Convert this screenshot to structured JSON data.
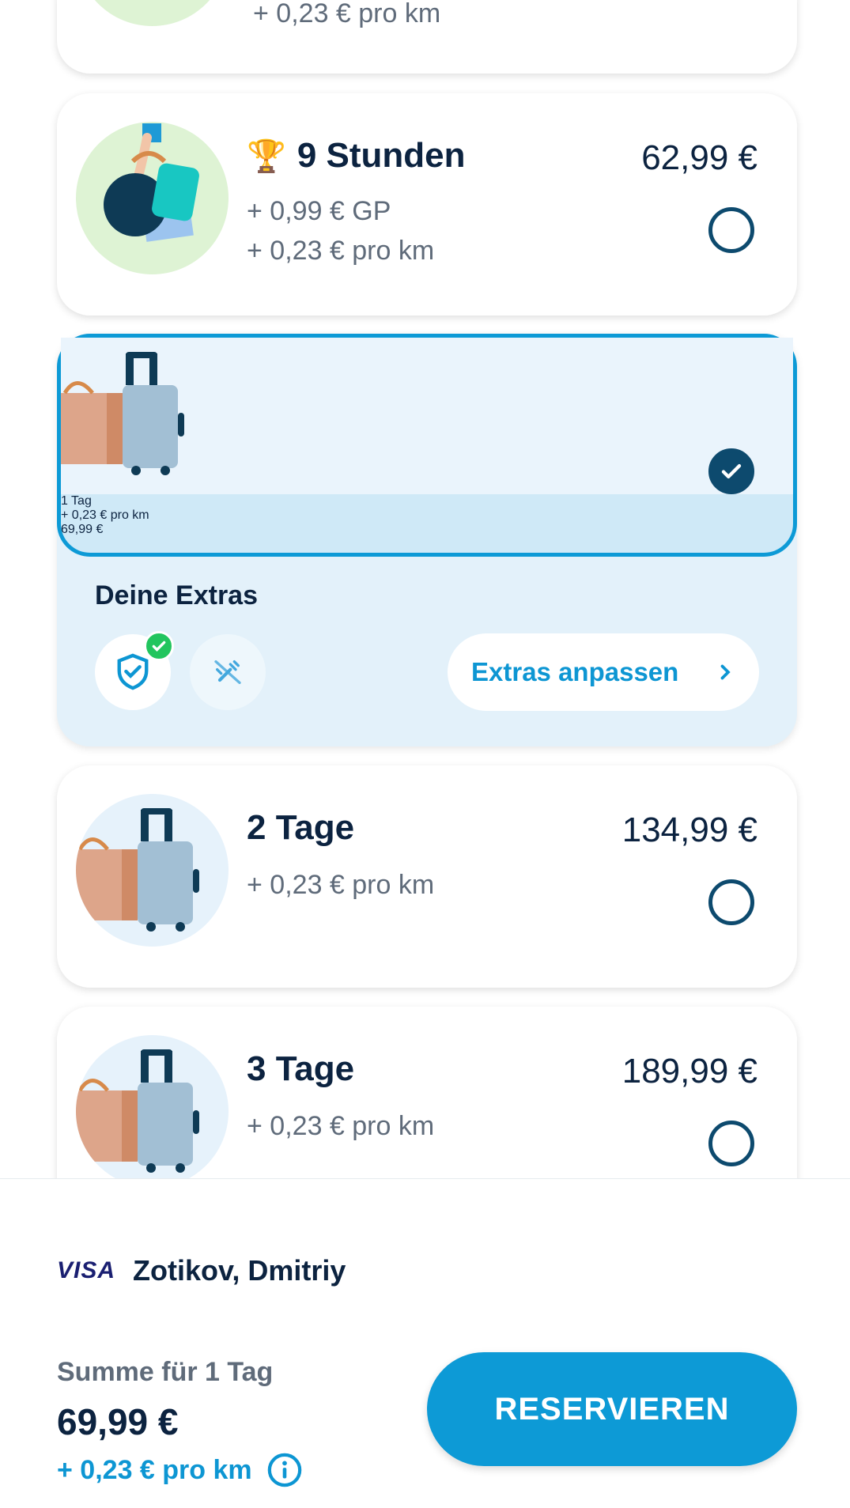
{
  "plans": [
    {
      "id": "prev",
      "sub": [
        "+ 0,23 € pro km"
      ],
      "selected": false
    },
    {
      "id": "9h",
      "trophy": "trophy-icon",
      "title": "9 Stunden",
      "price": "62,99 €",
      "sub": [
        "+ 0,99 € GP",
        "+ 0,23 € pro km"
      ],
      "selected": false
    },
    {
      "id": "1d",
      "title": "1 Tag",
      "price": "69,99 €",
      "sub": [
        "+ 0,23 € pro km"
      ],
      "selected": true
    },
    {
      "id": "2d",
      "title": "2 Tage",
      "price": "134,99 €",
      "sub": [
        "+ 0,23 € pro km"
      ],
      "selected": false
    },
    {
      "id": "3d",
      "title": "3 Tage",
      "price": "189,99 €",
      "sub": [
        "+ 0,23 € pro km"
      ],
      "selected": false
    }
  ],
  "extras": {
    "title": "Deine Extras",
    "button": "Extras anpassen",
    "icons": [
      "shield-check-icon",
      "no-cleaning-icon"
    ]
  },
  "payment": {
    "card_brand": "VISA",
    "holder": "Zotikov, Dmitriy"
  },
  "summary": {
    "label": "Summe für 1 Tag",
    "price": "69,99 €",
    "per_km": "+ 0,23 € pro km"
  },
  "reserve_button": "RESERVIEREN",
  "colors": {
    "accent": "#0d9ad6",
    "dark": "#0c2340",
    "radio": "#0d4a6e",
    "selected_bg": "#cfe9f7",
    "success": "#22c55e"
  }
}
